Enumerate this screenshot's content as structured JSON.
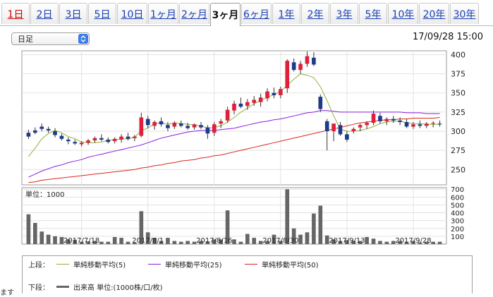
{
  "tabs": [
    {
      "label": "1日",
      "active": false,
      "red": true
    },
    {
      "label": "2日",
      "active": false
    },
    {
      "label": "3日",
      "active": false
    },
    {
      "label": "5日",
      "active": false
    },
    {
      "label": "10日",
      "active": false
    },
    {
      "label": "1ヶ月",
      "active": false
    },
    {
      "label": "2ヶ月",
      "active": false
    },
    {
      "label": "3ヶ月",
      "active": true
    },
    {
      "label": "6ヶ月",
      "active": false
    },
    {
      "label": "1年",
      "active": false
    },
    {
      "label": "2年",
      "active": false
    },
    {
      "label": "3年",
      "active": false
    },
    {
      "label": "5年",
      "active": false
    },
    {
      "label": "10年",
      "active": false
    },
    {
      "label": "20年",
      "active": false
    },
    {
      "label": "30年",
      "active": false
    }
  ],
  "selector": {
    "value": "日足"
  },
  "datetime": "17/09/28 15:00",
  "volume_unit_label": "単位：1000",
  "legend": {
    "upper_label": "上段：",
    "lower_label": "下段：",
    "ma5": "単純移動平均(5)",
    "ma25": "単純移動平均(25)",
    "ma50": "単純移動平均(50)",
    "volume": "出来高 単位:(1000株/口/枚)",
    "colors": {
      "ma5": "#8fb13a",
      "ma25": "#8a1ee0",
      "ma50": "#d8261c",
      "volume": "#666666",
      "up": "#e0203a",
      "down": "#1c3b8c"
    }
  },
  "cutoff_text": "ます",
  "chart_data": [
    {
      "type": "candlestick",
      "title": "",
      "yticks": [
        250,
        275,
        300,
        325,
        350,
        375,
        400
      ],
      "ylim": [
        230,
        405
      ],
      "xticks": [
        "2017/7/18",
        "2017/8/1",
        "2017/8/16",
        "2017/8/30",
        "2017/9/13",
        "2017/9/28"
      ],
      "xtick_index": [
        8,
        18,
        28,
        38,
        48,
        58
      ],
      "candles": [
        [
          298,
          302,
          290,
          293
        ],
        [
          301,
          305,
          296,
          298
        ],
        [
          306,
          310,
          300,
          303
        ],
        [
          303,
          306,
          298,
          301
        ],
        [
          300,
          304,
          292,
          295
        ],
        [
          294,
          297,
          288,
          290
        ],
        [
          289,
          292,
          283,
          287
        ],
        [
          286,
          289,
          282,
          284
        ],
        [
          283,
          287,
          280,
          285
        ],
        [
          285,
          290,
          282,
          288
        ],
        [
          288,
          293,
          285,
          291
        ],
        [
          291,
          296,
          287,
          289
        ],
        [
          289,
          292,
          284,
          286
        ],
        [
          287,
          292,
          284,
          290
        ],
        [
          289,
          296,
          285,
          293
        ],
        [
          293,
          298,
          288,
          290
        ],
        [
          291,
          295,
          287,
          293
        ],
        [
          294,
          324,
          292,
          318
        ],
        [
          316,
          320,
          304,
          308
        ],
        [
          307,
          314,
          302,
          312
        ],
        [
          313,
          318,
          306,
          309
        ],
        [
          308,
          312,
          300,
          304
        ],
        [
          306,
          313,
          303,
          311
        ],
        [
          310,
          314,
          305,
          307
        ],
        [
          307,
          311,
          302,
          304
        ],
        [
          305,
          310,
          302,
          309
        ],
        [
          308,
          312,
          303,
          305
        ],
        [
          305,
          308,
          290,
          297
        ],
        [
          298,
          312,
          294,
          309
        ],
        [
          310,
          316,
          304,
          313
        ],
        [
          314,
          332,
          311,
          328
        ],
        [
          327,
          340,
          322,
          336
        ],
        [
          336,
          344,
          330,
          332
        ],
        [
          333,
          342,
          328,
          338
        ],
        [
          337,
          346,
          333,
          341
        ],
        [
          338,
          349,
          332,
          344
        ],
        [
          343,
          356,
          339,
          352
        ],
        [
          350,
          357,
          343,
          347
        ],
        [
          347,
          358,
          343,
          355
        ],
        [
          356,
          394,
          350,
          392
        ],
        [
          390,
          395,
          378,
          380
        ],
        [
          380,
          392,
          375,
          388
        ],
        [
          388,
          404,
          384,
          398
        ],
        [
          396,
          403,
          385,
          387
        ],
        [
          345,
          348,
          325,
          329
        ],
        [
          313,
          316,
          275,
          300
        ],
        [
          300,
          308,
          287,
          310
        ],
        [
          308,
          312,
          294,
          296
        ],
        [
          296,
          300,
          286,
          289
        ],
        [
          300,
          305,
          297,
          303
        ],
        [
          305,
          310,
          300,
          308
        ],
        [
          308,
          313,
          303,
          311
        ],
        [
          311,
          327,
          308,
          323
        ],
        [
          320,
          324,
          310,
          313
        ],
        [
          313,
          318,
          308,
          316
        ],
        [
          316,
          320,
          311,
          314
        ],
        [
          314,
          318,
          308,
          312
        ],
        [
          312,
          316,
          304,
          306
        ],
        [
          306,
          312,
          303,
          309
        ],
        [
          309,
          314,
          304,
          307
        ],
        [
          307,
          312,
          304,
          310
        ],
        [
          310,
          313,
          305,
          311
        ],
        [
          310,
          314,
          306,
          309
        ]
      ],
      "ma5": [
        267,
        278,
        290,
        297,
        301,
        298,
        293,
        290,
        286,
        285,
        285,
        286,
        288,
        289,
        290,
        290,
        292,
        301,
        304,
        310,
        311,
        309,
        311,
        310,
        309,
        308,
        307,
        304,
        305,
        307,
        312,
        318,
        325,
        330,
        336,
        340,
        344,
        348,
        352,
        360,
        368,
        375,
        373,
        370,
        358,
        340,
        320,
        303,
        300,
        300,
        301,
        303,
        306,
        310,
        312,
        313,
        313,
        311,
        310,
        310,
        309,
        309,
        309
      ],
      "ma25": [
        240,
        244,
        248,
        251,
        254,
        256,
        259,
        261,
        263,
        266,
        268,
        270,
        272,
        274,
        276,
        278,
        280,
        282,
        285,
        288,
        291,
        293,
        295,
        297,
        299,
        300,
        301,
        301,
        301,
        302,
        303,
        304,
        306,
        308,
        310,
        312,
        313,
        315,
        316,
        318,
        320,
        322,
        324,
        325,
        327,
        327,
        326,
        325,
        325,
        325,
        325,
        325,
        325,
        325,
        325,
        325,
        325,
        324,
        324,
        324,
        323,
        323,
        323
      ],
      "ma50": [
        233,
        234,
        236,
        237,
        238,
        239,
        240,
        241,
        242,
        243,
        244,
        245,
        246,
        247,
        248,
        249,
        250,
        252,
        253,
        255,
        256,
        258,
        259,
        261,
        262,
        263,
        265,
        266,
        268,
        269,
        271,
        273,
        275,
        277,
        279,
        281,
        283,
        285,
        287,
        289,
        291,
        293,
        295,
        297,
        299,
        301,
        303,
        305,
        307,
        309,
        311,
        312,
        313,
        314,
        315,
        315,
        316,
        316,
        317,
        317,
        317,
        317,
        318
      ]
    },
    {
      "type": "bar",
      "title": "",
      "yticks": [
        100,
        200,
        300,
        400,
        500,
        600,
        700
      ],
      "ylim": [
        0,
        720
      ],
      "volumes": [
        380,
        270,
        160,
        120,
        100,
        90,
        60,
        55,
        30,
        35,
        40,
        30,
        30,
        90,
        80,
        30,
        20,
        420,
        150,
        80,
        40,
        80,
        40,
        30,
        40,
        30,
        40,
        35,
        60,
        60,
        430,
        60,
        30,
        130,
        80,
        40,
        40,
        120,
        40,
        700,
        200,
        120,
        150,
        390,
        490,
        110,
        60,
        40,
        50,
        40,
        40,
        90,
        70,
        40,
        30,
        40,
        40,
        30,
        40,
        20,
        30,
        30,
        30
      ]
    }
  ]
}
